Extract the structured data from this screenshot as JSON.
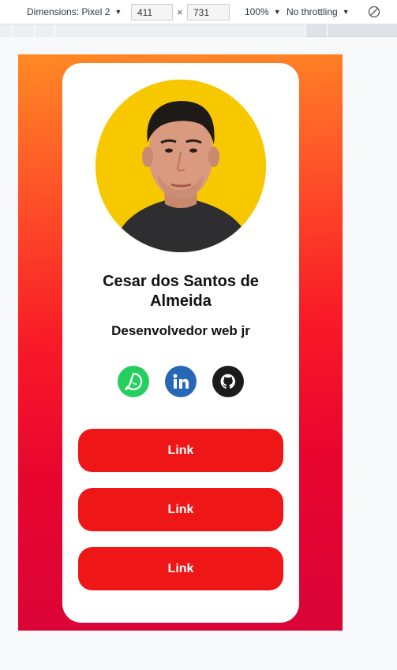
{
  "devtools": {
    "dimensions_label": "Dimensions: Pixel 2",
    "width_value": "411",
    "times": "×",
    "height_value": "731",
    "zoom": "100%",
    "throttling": "No throttling"
  },
  "profile": {
    "name": "Cesar dos Santos de Almeida",
    "role": "Desenvolvedor web jr"
  },
  "socials": [
    {
      "label": "WhatsApp",
      "icon": "whatsapp-icon",
      "color": "#25cf5e"
    },
    {
      "label": "LinkedIn",
      "icon": "linkedin-icon",
      "color": "#2767b6"
    },
    {
      "label": "GitHub",
      "icon": "github-icon",
      "color": "#1b1b1b"
    }
  ],
  "links": [
    "Link",
    "Link",
    "Link"
  ],
  "colors": {
    "gradient_top": "#ff8a24",
    "gradient_bottom": "#d90437",
    "button": "#ee1616",
    "avatar_bg": "#f7c800"
  }
}
